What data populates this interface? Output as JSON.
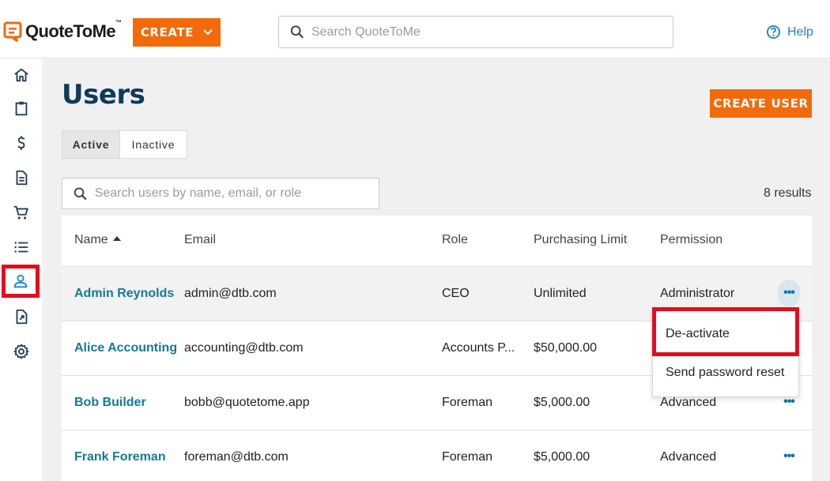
{
  "app": {
    "logo_text": "QuoteToMe",
    "logo_tm": "™",
    "create_label": "CREATE",
    "search_placeholder": "Search QuoteToMe",
    "help_label": "Help",
    "brand_color": "#f26a0a"
  },
  "sidebar": {
    "items": [
      {
        "icon": "home-icon"
      },
      {
        "icon": "clipboard-icon"
      },
      {
        "icon": "dollar-icon"
      },
      {
        "icon": "document-icon"
      },
      {
        "icon": "cart-icon"
      },
      {
        "icon": "list-icon"
      },
      {
        "icon": "user-icon",
        "active": true
      },
      {
        "icon": "report-icon"
      },
      {
        "icon": "gear-icon"
      }
    ]
  },
  "page": {
    "title": "Users",
    "create_user_label": "CREATE USER",
    "tabs": [
      "Active",
      "Inactive"
    ],
    "active_tab": "Active",
    "search_placeholder": "Search users by name, email, or role",
    "results": "8 results"
  },
  "table": {
    "columns": [
      "Name",
      "Email",
      "Role",
      "Purchasing Limit",
      "Permission"
    ],
    "sort_column": "Name",
    "rows": [
      {
        "name": "Admin Reynolds",
        "email": "admin@dtb.com",
        "role": "CEO",
        "limit": "Unlimited",
        "permission": "Administrator"
      },
      {
        "name": "Alice Accounting",
        "email": "accounting@dtb.com",
        "role": "Accounts P...",
        "limit": "$50,000.00",
        "permission": ""
      },
      {
        "name": "Bob Builder",
        "email": "bobb@quotetome.app",
        "role": "Foreman",
        "limit": "$5,000.00",
        "permission": "Advanced"
      },
      {
        "name": "Frank Foreman",
        "email": "foreman@dtb.com",
        "role": "Foreman",
        "limit": "$5,000.00",
        "permission": "Advanced"
      }
    ],
    "row_menu_label": "•••"
  },
  "menu": {
    "items": [
      "De-activate",
      "Send password reset"
    ]
  }
}
